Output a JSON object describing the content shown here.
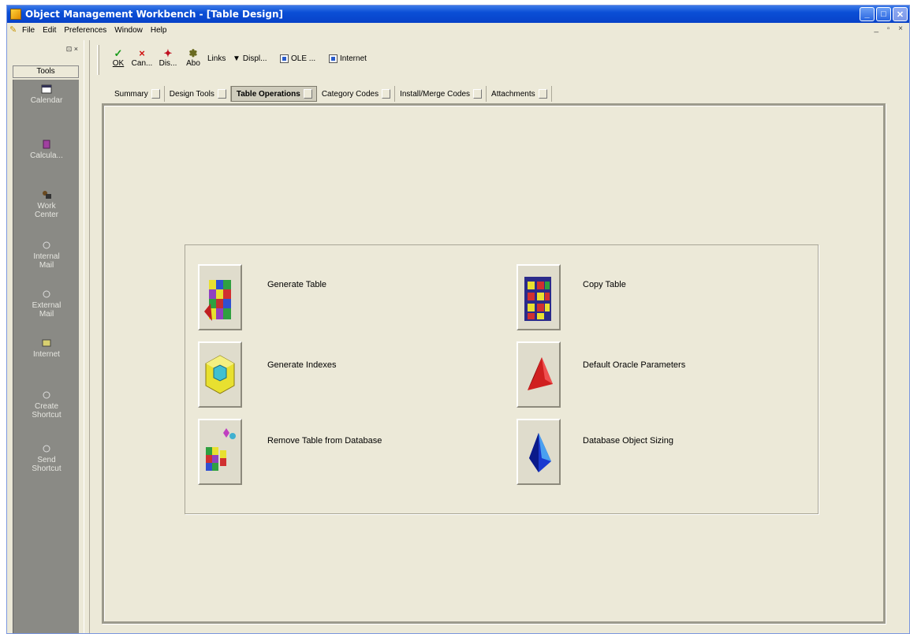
{
  "window": {
    "title": "Object Management Workbench - [Table Design]",
    "controls": [
      "_",
      "□",
      "✕"
    ]
  },
  "menu": {
    "items": [
      "File",
      "Edit",
      "Preferences",
      "Window",
      "Help"
    ],
    "mdi_controls": "_ ▫ ×"
  },
  "tools_pane": {
    "controls": "⊡ ×",
    "header": "Tools",
    "items": [
      {
        "label": "Calendar",
        "icon": "calendar-icon"
      },
      {
        "label": "Calcula...",
        "icon": "calculator-icon"
      },
      {
        "label": "Work Center",
        "icon": "work-center-icon"
      },
      {
        "label": "Internal Mail",
        "icon": "mail-icon"
      },
      {
        "label": "External Mail",
        "icon": "mail-icon"
      },
      {
        "label": "Internet",
        "icon": "internet-icon"
      },
      {
        "label": "Create Shortcut",
        "icon": "shortcut-icon"
      },
      {
        "label": "Send Shortcut",
        "icon": "send-icon"
      }
    ]
  },
  "toolbar": {
    "ok": "OK",
    "cancel": "Can...",
    "display": "Dis...",
    "abo": "Abo",
    "links": "Links",
    "disp": "Displ...",
    "ole": "OLE ...",
    "internet": "Internet"
  },
  "tabs": [
    {
      "label": "Summary",
      "active": false
    },
    {
      "label": "Design Tools",
      "active": false
    },
    {
      "label": "Table Operations",
      "active": true
    },
    {
      "label": "Category Codes",
      "active": false
    },
    {
      "label": "Install/Merge Codes",
      "active": false
    },
    {
      "label": "Attachments",
      "active": false
    }
  ],
  "operations": {
    "generate_table": "Generate Table",
    "generate_indexes": "Generate Indexes",
    "remove_table": "Remove Table from Database",
    "copy_table": "Copy Table",
    "default_oracle": "Default Oracle Parameters",
    "db_sizing": "Database Object Sizing"
  },
  "colors": {
    "titlebar": "#0a4fd6",
    "face": "#ece9d8",
    "tools_bg": "#8a8a85"
  }
}
